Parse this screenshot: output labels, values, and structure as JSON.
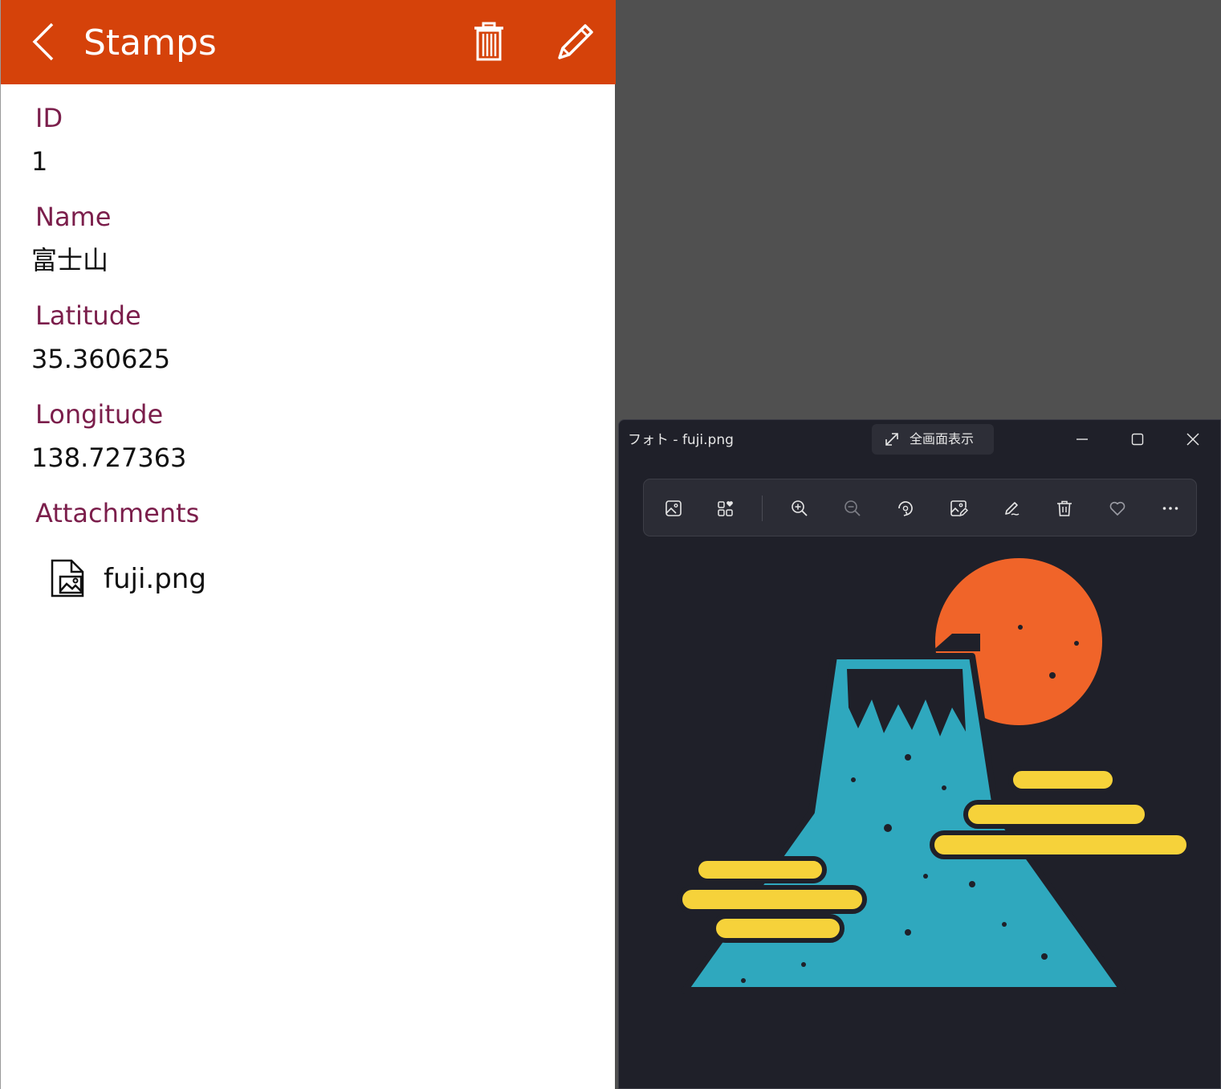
{
  "app": {
    "title": "Stamps",
    "header_color": "#d5420a",
    "label_color": "#7b1e4b",
    "fields": [
      {
        "label": "ID",
        "value": "1"
      },
      {
        "label": "Name",
        "value": "富士山"
      },
      {
        "label": "Latitude",
        "value": "35.360625"
      },
      {
        "label": "Longitude",
        "value": "138.727363"
      }
    ],
    "attachments_label": "Attachments",
    "attachments": [
      {
        "name": "fuji.png",
        "icon": "image-file-icon"
      }
    ],
    "icons": [
      "back-chevron-icon",
      "trash-icon",
      "pencil-icon"
    ]
  },
  "photos": {
    "window_title": "フォト - fuji.png",
    "fullscreen_label": "全画面表示",
    "caption_buttons": [
      "minimize-icon",
      "maximize-icon",
      "close-icon"
    ],
    "toolbar_icons": [
      "view-image-icon",
      "collection-icon",
      "zoom-in-icon",
      "zoom-out-icon",
      "rotate-icon",
      "edit-image-icon",
      "markup-icon",
      "delete-icon",
      "favorite-icon",
      "more-icon"
    ],
    "background_color": "#1f2029"
  }
}
